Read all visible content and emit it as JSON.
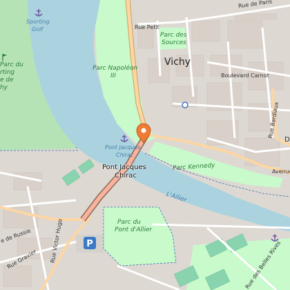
{
  "map": {
    "colors": {
      "water": "#aad3df",
      "park": "#c8facc",
      "golf": "#b5e3b5",
      "built": "#ddd8d2",
      "buildings": "#d9d0c9",
      "road_major": "#fcd6a4",
      "road_primary": "#f9b29c",
      "road_minor": "#ffffff",
      "marker": "#f07b35"
    },
    "places": {
      "city": "Vichy",
      "bridge": "Pont Jacques Chirac",
      "bridge_line1": "Pont Jacques",
      "bridge_line2": "Chirac"
    },
    "parks": {
      "napoleon_line1": "Parc Napoléon",
      "napoleon_line2": "III",
      "sources_line1": "Parc des",
      "sources_line2": "Sources",
      "kennedy": "Parc Kennedy",
      "allier_line1": "Parc du",
      "allier_line2": "Pont d'Allier",
      "left_line1": "Parc du",
      "left_line2": "rting",
      "left_line3": "e de",
      "left_line4": "hy"
    },
    "water": {
      "river": "L'Allier",
      "marina_line1": "Pont Jacques",
      "marina_line2": "Chirac",
      "sporting_line1": "Sporting",
      "sporting_line2": "Golf"
    },
    "streets": {
      "paris": "Rue de Paris",
      "petit": "Rue Petit",
      "carnot": "Boulevard Carnot",
      "bardiaux": "Rue Bardiaux",
      "avenue": "Avenue",
      "russie": "e de Russie",
      "victor_hugo": "Rue Victor Hugo",
      "gravier": "Rue Gravier",
      "belles_rives": "Rue des Belles Rives",
      "d_label": "D"
    },
    "icons": [
      "marina-icon",
      "map-pin-marker",
      "parking-icon",
      "golf-icon"
    ]
  }
}
